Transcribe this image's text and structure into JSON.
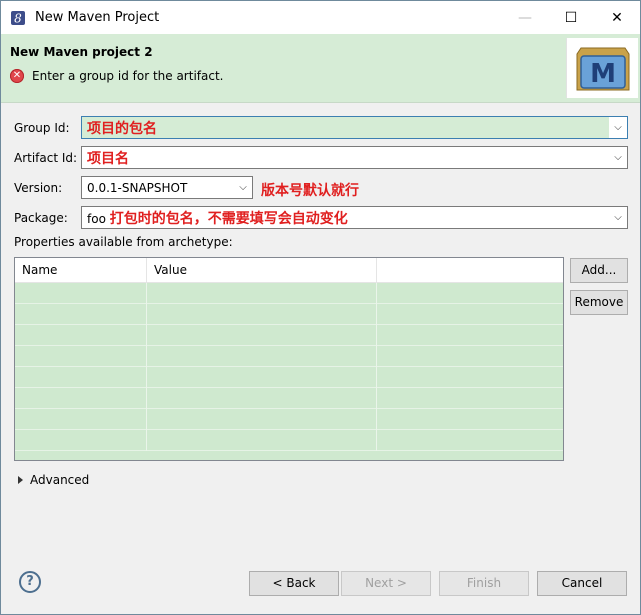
{
  "window": {
    "title": "New Maven Project",
    "controls": {
      "minimize": "—",
      "maximize": "☐",
      "close": "✕"
    }
  },
  "banner": {
    "title": "New Maven project 2",
    "message": "Enter a group id for the artifact.",
    "logo_letter": "M"
  },
  "form": {
    "group_id": {
      "label": "Group Id:",
      "value": "",
      "annotation": "项目的包名"
    },
    "artifact_id": {
      "label": "Artifact Id:",
      "value": "",
      "annotation": "项目名"
    },
    "version": {
      "label": "Version:",
      "value": "0.0.1-SNAPSHOT",
      "annotation": "版本号默认就行"
    },
    "package": {
      "label": "Package:",
      "value": "foo",
      "annotation": "打包时的包名，不需要填写会自动变化"
    }
  },
  "properties": {
    "label": "Properties available from archetype:",
    "columns": [
      "Name",
      "Value",
      ""
    ],
    "add_button": "Add...",
    "remove_button": "Remove"
  },
  "advanced": {
    "label": "Advanced"
  },
  "footer": {
    "help": "?",
    "back": "< Back",
    "next": "Next >",
    "finish": "Finish",
    "cancel": "Cancel"
  },
  "colors": {
    "banner_bg": "#d6ecd6",
    "table_bg": "#cfe9cf",
    "annotation": "#e02020"
  }
}
